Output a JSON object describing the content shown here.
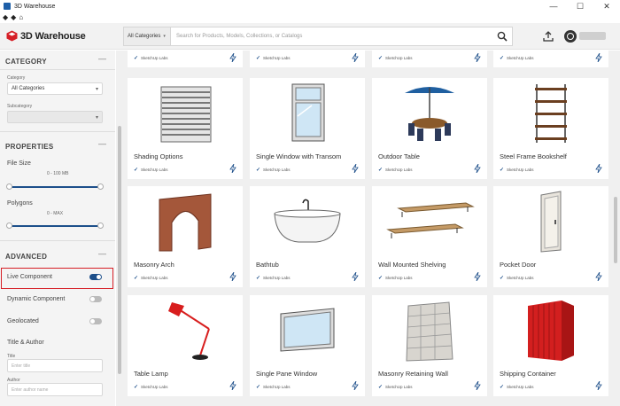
{
  "window": {
    "title": "3D Warehouse",
    "controls": [
      "—",
      "☐",
      "✕"
    ]
  },
  "nav": {
    "back": "◆",
    "forward": "◆",
    "home": "⌂"
  },
  "header": {
    "logo_text": "3D Warehouse",
    "category_select": "All Categories",
    "search_placeholder": "Search for Products, Models, Collections, or Catalogs",
    "icons": [
      "search-icon",
      "upload-icon",
      "avatar-icon"
    ]
  },
  "sidebar": {
    "category": {
      "heading": "CATEGORY",
      "category_label": "Category",
      "category_value": "All Categories",
      "subcategory_label": "Subcategory",
      "subcategory_value": ""
    },
    "properties": {
      "heading": "PROPERTIES",
      "file_size_label": "File Size",
      "file_size_range": "0 - 100 MB",
      "polygons_label": "Polygons",
      "polygons_range": "0 - MAX"
    },
    "advanced": {
      "heading": "ADVANCED",
      "toggles": [
        {
          "label": "Live Component",
          "on": true
        },
        {
          "label": "Dynamic Component",
          "on": false
        },
        {
          "label": "Geolocated",
          "on": false
        }
      ],
      "title_author_heading": "Title & Author",
      "title_label": "Title",
      "title_placeholder": "Enter title",
      "author_label": "Author",
      "author_placeholder": "Enter author name"
    },
    "collapse_symbol": "—"
  },
  "cards": [
    {
      "title": "",
      "author": "SketchUp Labs"
    },
    {
      "title": "",
      "author": "SketchUp Labs"
    },
    {
      "title": "",
      "author": "SketchUp Labs"
    },
    {
      "title": "",
      "author": "SketchUp Labs"
    },
    {
      "title": "Shading Options",
      "author": "SketchUp Labs"
    },
    {
      "title": "Single Window with Transom",
      "author": "SketchUp Labs"
    },
    {
      "title": "Outdoor Table",
      "author": "SketchUp Labs"
    },
    {
      "title": "Steel Frame Bookshelf",
      "author": "SketchUp Labs"
    },
    {
      "title": "Masonry Arch",
      "author": "SketchUp Labs"
    },
    {
      "title": "Bathtub",
      "author": "SketchUp Labs"
    },
    {
      "title": "Wall Mounted Shelving",
      "author": "SketchUp Labs"
    },
    {
      "title": "Pocket Door",
      "author": "SketchUp Labs"
    },
    {
      "title": "Table Lamp",
      "author": "SketchUp Labs"
    },
    {
      "title": "Single Pane Window",
      "author": "SketchUp Labs"
    },
    {
      "title": "Masonry Retaining Wall",
      "author": "SketchUp Labs"
    },
    {
      "title": "Shipping Container",
      "author": "SketchUp Labs"
    }
  ],
  "colors": {
    "accent": "#1d4f8a",
    "highlight": "#d61f26",
    "logo_red": "#d61f26"
  }
}
